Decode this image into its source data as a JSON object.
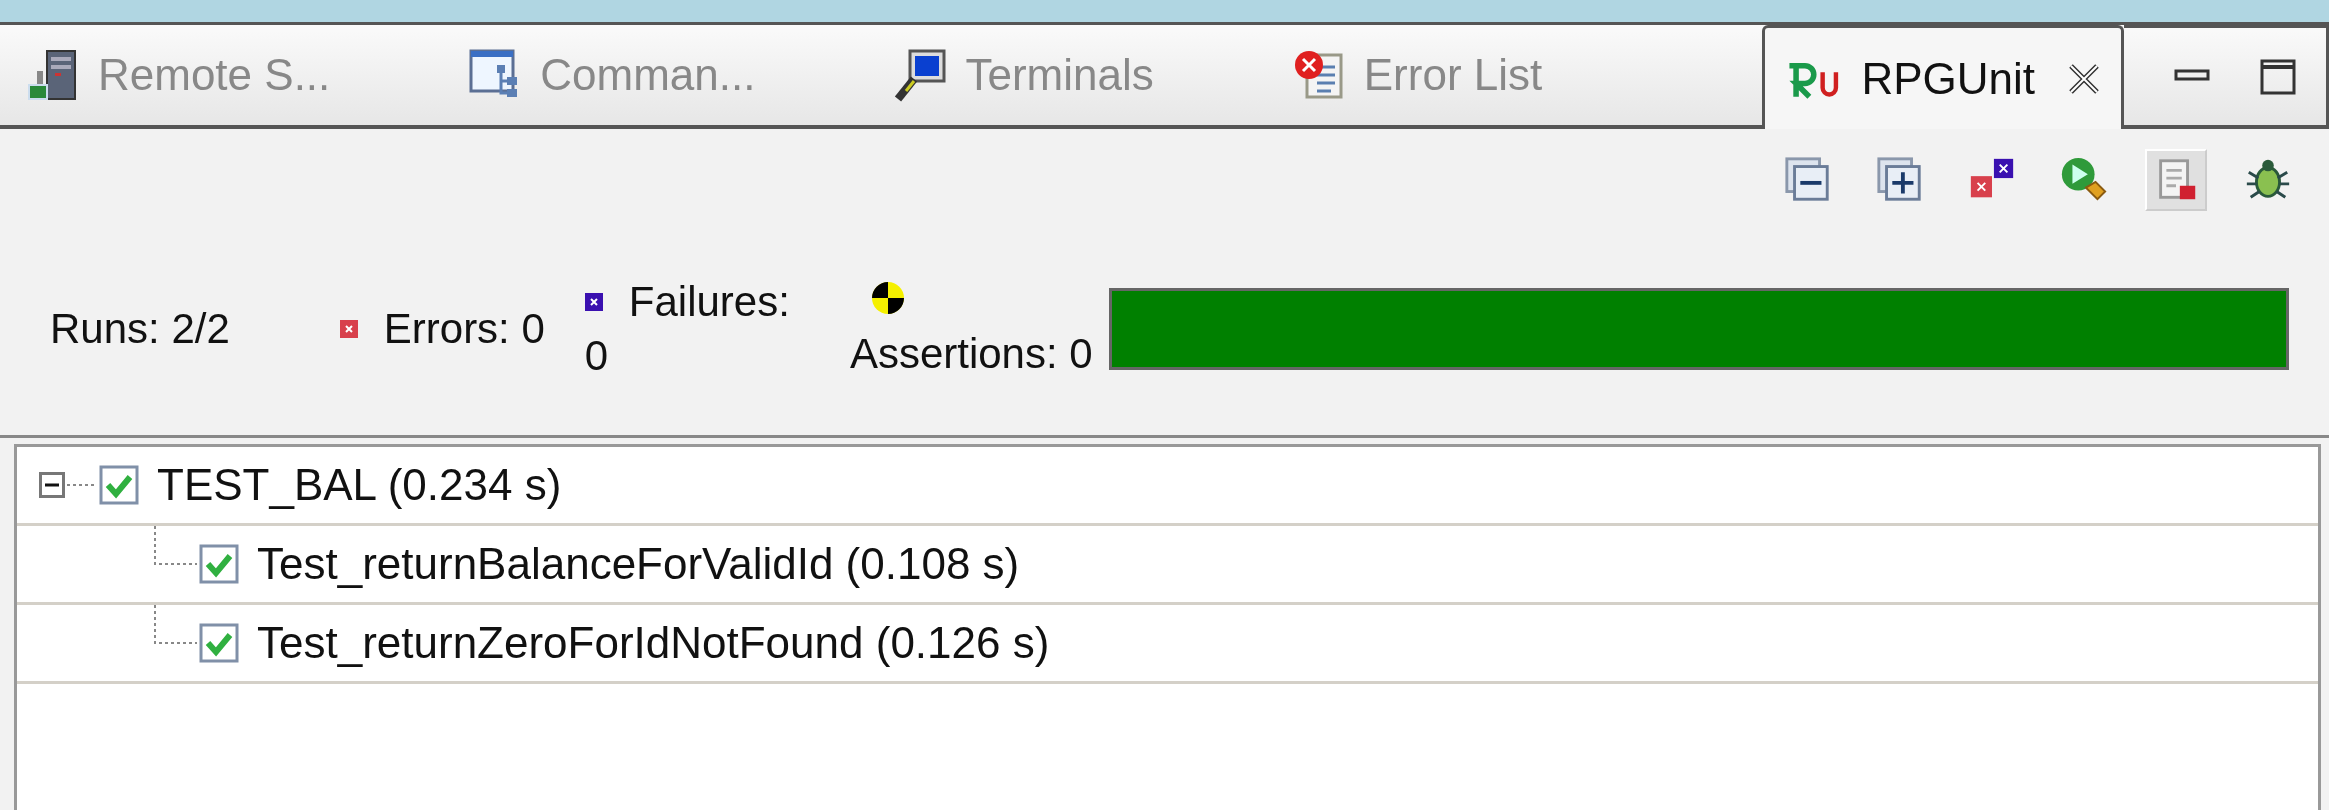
{
  "tabs": [
    {
      "kind": "server",
      "label": "Remote S...",
      "selected": false
    },
    {
      "kind": "commands",
      "label": "Comman...",
      "selected": false
    },
    {
      "kind": "terminal",
      "label": "Terminals",
      "selected": false
    },
    {
      "kind": "errors",
      "label": "Error List",
      "selected": false
    },
    {
      "kind": "rpgunit",
      "label": "RPGUnit",
      "selected": true
    }
  ],
  "toolbar": [
    {
      "kind": "collapse",
      "pressed": false
    },
    {
      "kind": "expand",
      "pressed": false
    },
    {
      "kind": "failures",
      "pressed": false
    },
    {
      "kind": "rerun",
      "pressed": false
    },
    {
      "kind": "report",
      "pressed": true
    },
    {
      "kind": "debug",
      "pressed": false
    }
  ],
  "stats": {
    "runs": "Runs: 2/2",
    "errors": "Errors: 0",
    "failures_label": "Failures:",
    "failures_value": "0",
    "assertions": "Assertions: 0",
    "progress": {
      "level": 1,
      "passed": true
    }
  },
  "tree": [
    {
      "label": "TEST_BAL (0.234 s)",
      "passed": true,
      "expanded": true,
      "children": [
        {
          "label": "Test_returnBalanceForValidId  (0.108 s)",
          "passed": true
        },
        {
          "label": "Test_returnZeroForIdNotFound  (0.126 s)",
          "passed": true
        }
      ]
    }
  ]
}
